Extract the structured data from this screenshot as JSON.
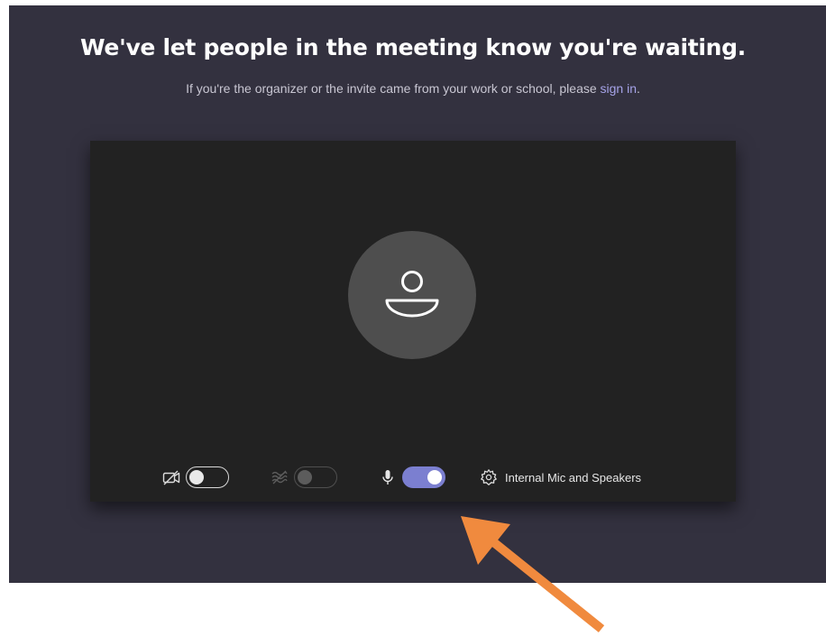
{
  "prejoin": {
    "headline": "We've let people in the meeting know you're waiting.",
    "subtext_before": "If you're the organizer or the invite came from your work or school, please ",
    "signin_link": "sign in",
    "subtext_after": "."
  },
  "controls": {
    "camera": {
      "icon": "camera-off-icon",
      "enabled": false
    },
    "background_blur": {
      "icon": "background-blur-icon",
      "enabled": false,
      "disabled": true
    },
    "microphone": {
      "icon": "microphone-icon",
      "enabled": true
    },
    "device_settings": {
      "icon": "gear-icon",
      "label": "Internal Mic and Speakers"
    }
  },
  "colors": {
    "app_background": "#33313f",
    "preview_background": "#222222",
    "avatar_background": "#4e4e4e",
    "accent": "#7b7fd0",
    "link": "#a6a3e8",
    "annotation_arrow": "#f08a3e"
  },
  "annotation": {
    "type": "arrow",
    "points_to": "microphone-toggle"
  }
}
